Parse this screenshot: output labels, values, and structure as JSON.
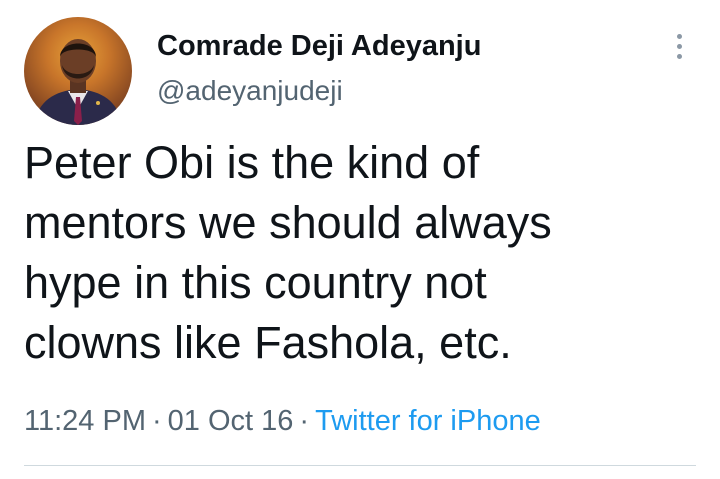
{
  "author": {
    "display_name": "Comrade Deji Adeyanju",
    "handle": "@adeyanjudeji"
  },
  "tweet": {
    "lines": [
      "Peter Obi is the kind of",
      "mentors we should always",
      "hype in this country not",
      "clowns like Fashola, etc."
    ]
  },
  "meta": {
    "time": "11:24 PM",
    "separator": "·",
    "date": "01 Oct 16",
    "source": "Twitter for iPhone"
  },
  "colors": {
    "text_primary": "#0f1419",
    "text_secondary": "#536471",
    "link": "#1d9bf0"
  },
  "icons": {
    "more": "vertical-ellipsis-icon"
  }
}
